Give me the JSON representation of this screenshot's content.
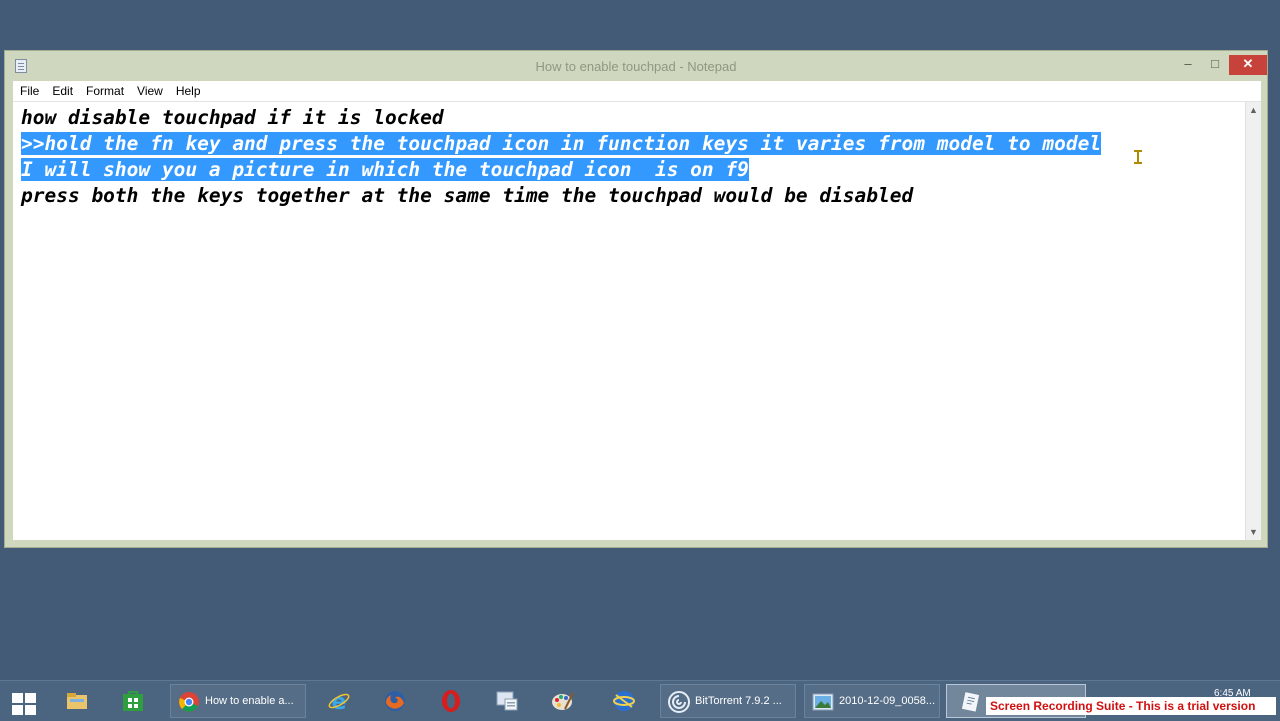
{
  "window": {
    "title": "How to enable touchpad - Notepad",
    "controls": {
      "minimize": "–",
      "maximize": "□",
      "close": "✕"
    }
  },
  "menu": [
    "File",
    "Edit",
    "Format",
    "View",
    "Help"
  ],
  "document": {
    "lines": [
      "how disable touchpad if it is locked",
      ">>hold the fn key and press the touchpad icon in function keys it varies from model to model",
      "I will show you a picture in which the touchpad icon  is on f9",
      "press both the keys together at the same time the touchpad would be disabled"
    ],
    "selected_lines": [
      1,
      2
    ]
  },
  "scrollbar": {
    "up": "▲",
    "down": "▼"
  },
  "taskbar": {
    "items": [
      {
        "label": "",
        "icon": "start-icon"
      },
      {
        "label": "",
        "icon": "file-explorer-icon"
      },
      {
        "label": "",
        "icon": "store-icon"
      },
      {
        "label": "How to enable a...",
        "icon": "chrome-icon"
      },
      {
        "label": "",
        "icon": "internet-explorer-icon"
      },
      {
        "label": "",
        "icon": "firefox-icon"
      },
      {
        "label": "",
        "icon": "opera-icon"
      },
      {
        "label": "",
        "icon": "control-panel-icon"
      },
      {
        "label": "",
        "icon": "paint-icon"
      },
      {
        "label": "",
        "icon": "network-icon"
      },
      {
        "label": "BitTorrent 7.9.2 ...",
        "icon": "bittorrent-icon"
      },
      {
        "label": "2010-12-09_0058...",
        "icon": "image-viewer-icon"
      },
      {
        "label": "",
        "icon": "notepad-icon"
      }
    ],
    "clock_time": "6:45 AM"
  },
  "watermark": "Screen Recording Suite - This is a trial version",
  "colors": {
    "selection": "#3399ff",
    "window_frame": "#cfd7be",
    "taskbar": "#4b6480"
  }
}
